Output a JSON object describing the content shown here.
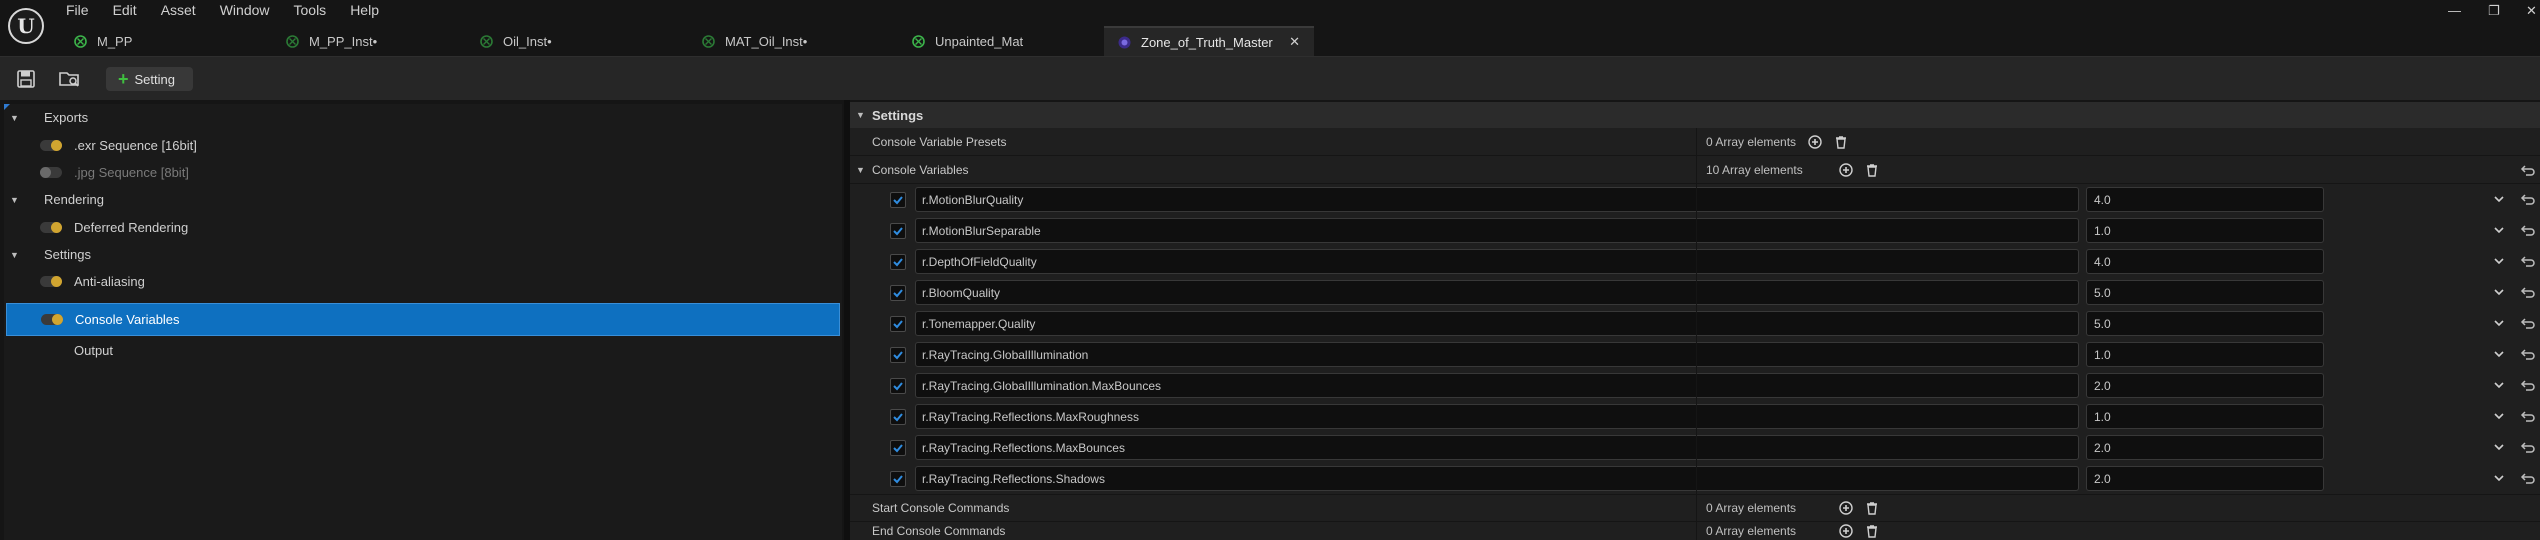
{
  "app": {
    "logo_text": "U",
    "menu": [
      "File",
      "Edit",
      "Asset",
      "Window",
      "Tools",
      "Help"
    ],
    "window_controls": {
      "minimize": "—",
      "restore": "❐",
      "close": "✕"
    }
  },
  "tabs": [
    {
      "label": "M_PP",
      "icon": "material-icon",
      "active": false
    },
    {
      "label": "M_PP_Inst•",
      "icon": "material-instance-icon",
      "active": false
    },
    {
      "label": "Oil_Inst•",
      "icon": "material-instance-icon",
      "active": false
    },
    {
      "label": "MAT_Oil_Inst•",
      "icon": "material-instance-icon",
      "active": false
    },
    {
      "label": "Unpainted_Mat",
      "icon": "material-icon",
      "active": false
    },
    {
      "label": "Zone_of_Truth_Master",
      "icon": "movie-pipeline-config-icon",
      "active": true,
      "close": "✕"
    }
  ],
  "toolbar": {
    "save_icon": "save-icon",
    "browse_icon": "browse-asset-icon",
    "add_setting_label": "Setting"
  },
  "tree": {
    "exports_label": "Exports",
    "exr_label": ".exr Sequence [16bit]",
    "jpg_label": ".jpg Sequence [8bit]",
    "rendering_label": "Rendering",
    "deferred_label": "Deferred Rendering",
    "settings_label": "Settings",
    "antialiasing_label": "Anti-aliasing",
    "console_vars_label": "Console Variables",
    "output_label": "Output"
  },
  "details": {
    "section_title": "Settings",
    "presets": {
      "label": "Console Variable Presets",
      "value": "0 Array elements"
    },
    "console_variables": {
      "label": "Console Variables",
      "value": "10 Array elements"
    },
    "variables": [
      {
        "name": "r.MotionBlurQuality",
        "value": "4.0",
        "enabled": true
      },
      {
        "name": "r.MotionBlurSeparable",
        "value": "1.0",
        "enabled": true
      },
      {
        "name": "r.DepthOfFieldQuality",
        "value": "4.0",
        "enabled": true
      },
      {
        "name": "r.BloomQuality",
        "value": "5.0",
        "enabled": true
      },
      {
        "name": "r.Tonemapper.Quality",
        "value": "5.0",
        "enabled": true
      },
      {
        "name": "r.RayTracing.GlobalIllumination",
        "value": "1.0",
        "enabled": true
      },
      {
        "name": "r.RayTracing.GlobalIllumination.MaxBounces",
        "value": "2.0",
        "enabled": true
      },
      {
        "name": "r.RayTracing.Reflections.MaxRoughness",
        "value": "1.0",
        "enabled": true
      },
      {
        "name": "r.RayTracing.Reflections.MaxBounces",
        "value": "2.0",
        "enabled": true
      },
      {
        "name": "r.RayTracing.Reflections.Shadows",
        "value": "2.0",
        "enabled": true
      }
    ],
    "start_commands": {
      "label": "Start Console Commands",
      "value": "0 Array elements"
    },
    "end_commands": {
      "label": "End Console Commands",
      "value": "0 Array elements"
    }
  },
  "colors": {
    "selection": "#0e70c0",
    "toggle_on": "#d1a530",
    "add_green": "#3fbf3f",
    "material_icon_green": "#3cb44a",
    "config_icon_purple": "#5a3cc0"
  }
}
